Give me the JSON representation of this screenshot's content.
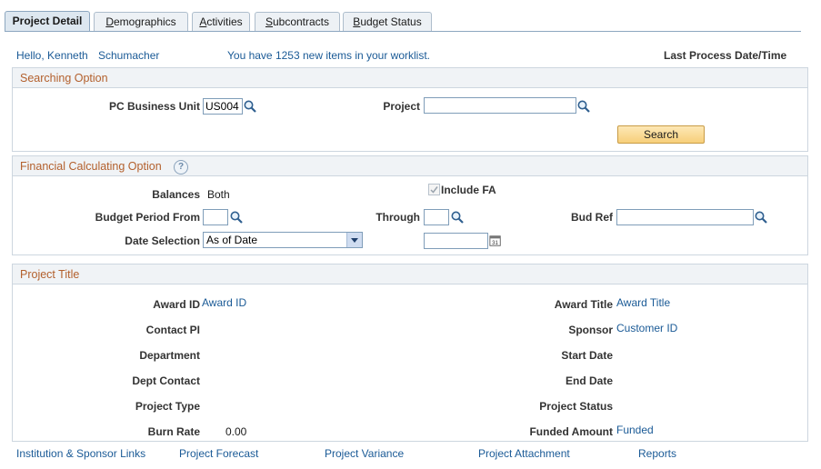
{
  "tabs": [
    {
      "label": "Project Detail",
      "accel": "",
      "rest": ""
    },
    {
      "accel": "D",
      "rest": "emographics"
    },
    {
      "accel": "A",
      "rest": "ctivities"
    },
    {
      "accel": "S",
      "rest": "ubcontracts"
    },
    {
      "accel": "B",
      "rest": "udget Status"
    }
  ],
  "header": {
    "greeting": "Hello, Kenneth",
    "user_last": "Schumacher",
    "worklist": "You have 1253 new items in your worklist.",
    "last_process": "Last Process Date/Time"
  },
  "searching": {
    "title": "Searching Option",
    "bu_label": "PC Business Unit",
    "bu_value": "US004",
    "project_label": "Project",
    "project_value": "",
    "search_button": "Search"
  },
  "financial": {
    "title": "Financial Calculating Option",
    "help": "?",
    "balances_label": "Balances",
    "balances_value": "Both",
    "include_fa": "Include FA",
    "bud_period_from_label": "Budget Period From",
    "through_label": "Through",
    "bud_ref_label": "Bud Ref",
    "date_selection_label": "Date Selection",
    "date_selection_value": "As of Date"
  },
  "project_title": {
    "title": "Project Title",
    "award_id_label": "Award ID",
    "award_id_value": "Award ID",
    "award_title_label": "Award Title",
    "award_title_value": "Award Title",
    "contact_pi_label": "Contact PI",
    "sponsor_label": "Sponsor",
    "sponsor_value": "Customer ID",
    "department_label": "Department",
    "start_date_label": "Start Date",
    "dept_contact_label": "Dept Contact",
    "end_date_label": "End Date",
    "project_type_label": "Project Type",
    "project_status_label": "Project Status",
    "burn_rate_label": "Burn Rate",
    "burn_rate_value": "0.00",
    "funded_amount_label": "Funded Amount",
    "funded_amount_value": "Funded"
  },
  "footer_links": [
    "Institution & Sponsor Links",
    "Project Forecast",
    "Project Variance",
    "Project Attachment",
    "Reports"
  ]
}
